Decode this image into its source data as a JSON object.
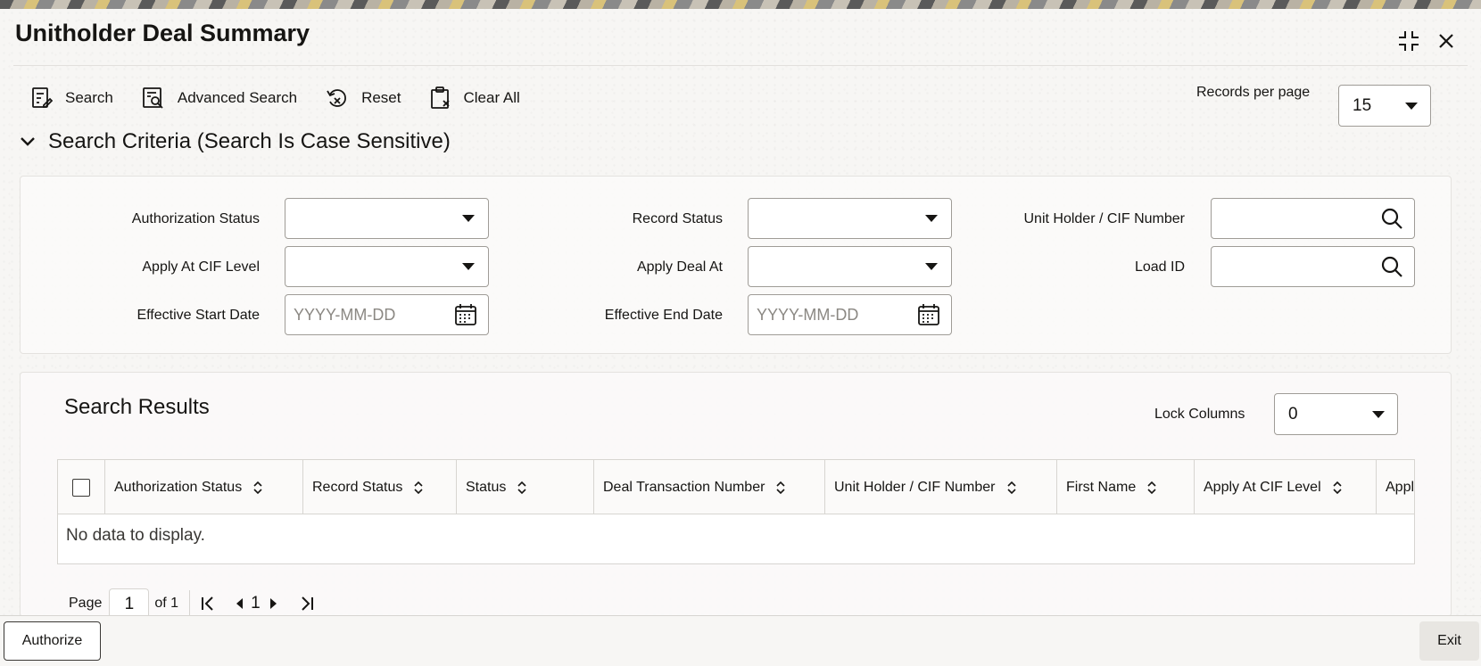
{
  "window": {
    "title": "Unitholder Deal Summary"
  },
  "toolbar": {
    "search": "Search",
    "advanced_search": "Advanced Search",
    "reset": "Reset",
    "clear_all": "Clear All",
    "records_per_page_label": "Records per page",
    "records_per_page_value": "15"
  },
  "criteria": {
    "heading": "Search Criteria (Search Is Case Sensitive)",
    "fields": {
      "authorization_status": {
        "label": "Authorization Status",
        "value": ""
      },
      "record_status": {
        "label": "Record Status",
        "value": ""
      },
      "unit_holder_cif": {
        "label": "Unit Holder / CIF Number",
        "value": ""
      },
      "apply_at_cif_level": {
        "label": "Apply At CIF Level",
        "value": ""
      },
      "apply_deal_at": {
        "label": "Apply Deal At",
        "value": ""
      },
      "load_id": {
        "label": "Load ID",
        "value": ""
      },
      "effective_start_date": {
        "label": "Effective Start Date",
        "placeholder": "YYYY-MM-DD"
      },
      "effective_end_date": {
        "label": "Effective End Date",
        "placeholder": "YYYY-MM-DD"
      }
    }
  },
  "results": {
    "title": "Search Results",
    "lock_columns_label": "Lock Columns",
    "lock_columns_value": "0",
    "columns": [
      "Authorization Status",
      "Record Status",
      "Status",
      "Deal Transaction Number",
      "Unit Holder / CIF Number",
      "First Name",
      "Apply At CIF Level",
      "Appl"
    ],
    "empty_message": "No data to display."
  },
  "pager": {
    "page_label": "Page",
    "page_value": "1",
    "of_label": "of 1",
    "current": "1"
  },
  "footer": {
    "authorize": "Authorize",
    "exit": "Exit"
  }
}
